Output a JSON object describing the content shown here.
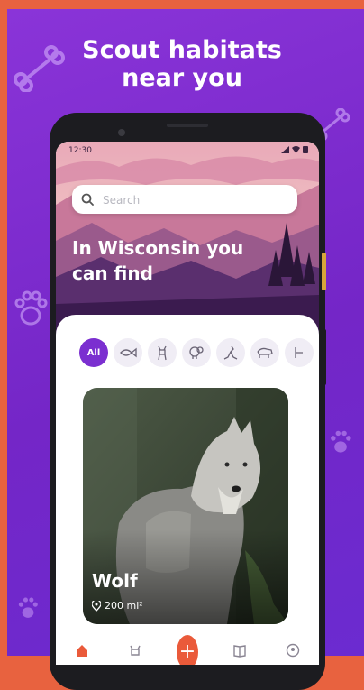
{
  "promo": {
    "headline_line1": "Scout habitats",
    "headline_line2": "near you"
  },
  "status_bar": {
    "time": "12:30"
  },
  "search": {
    "placeholder": "Search"
  },
  "hero": {
    "title_line1": "In Wisconsin you",
    "title_line2": "can find"
  },
  "filters": {
    "chips": [
      {
        "label": "All",
        "active": true
      },
      {
        "icon": "fish-icon"
      },
      {
        "icon": "deer-icon"
      },
      {
        "icon": "sheep-icon"
      },
      {
        "icon": "kangaroo-icon"
      },
      {
        "icon": "bison-icon"
      },
      {
        "icon": "more-animal-icon"
      }
    ]
  },
  "card": {
    "name": "Wolf",
    "area": "200 mi²"
  },
  "bottom_nav": {
    "items": [
      "home-icon",
      "animal-icon",
      "add-icon",
      "book-icon",
      "profile-icon"
    ],
    "fab_label": "+"
  },
  "colors": {
    "background_frame": "#e8623f",
    "promo_purple": "#7a2ccf",
    "accent": "#7b2fd0",
    "fab": "#ea5a3a"
  }
}
